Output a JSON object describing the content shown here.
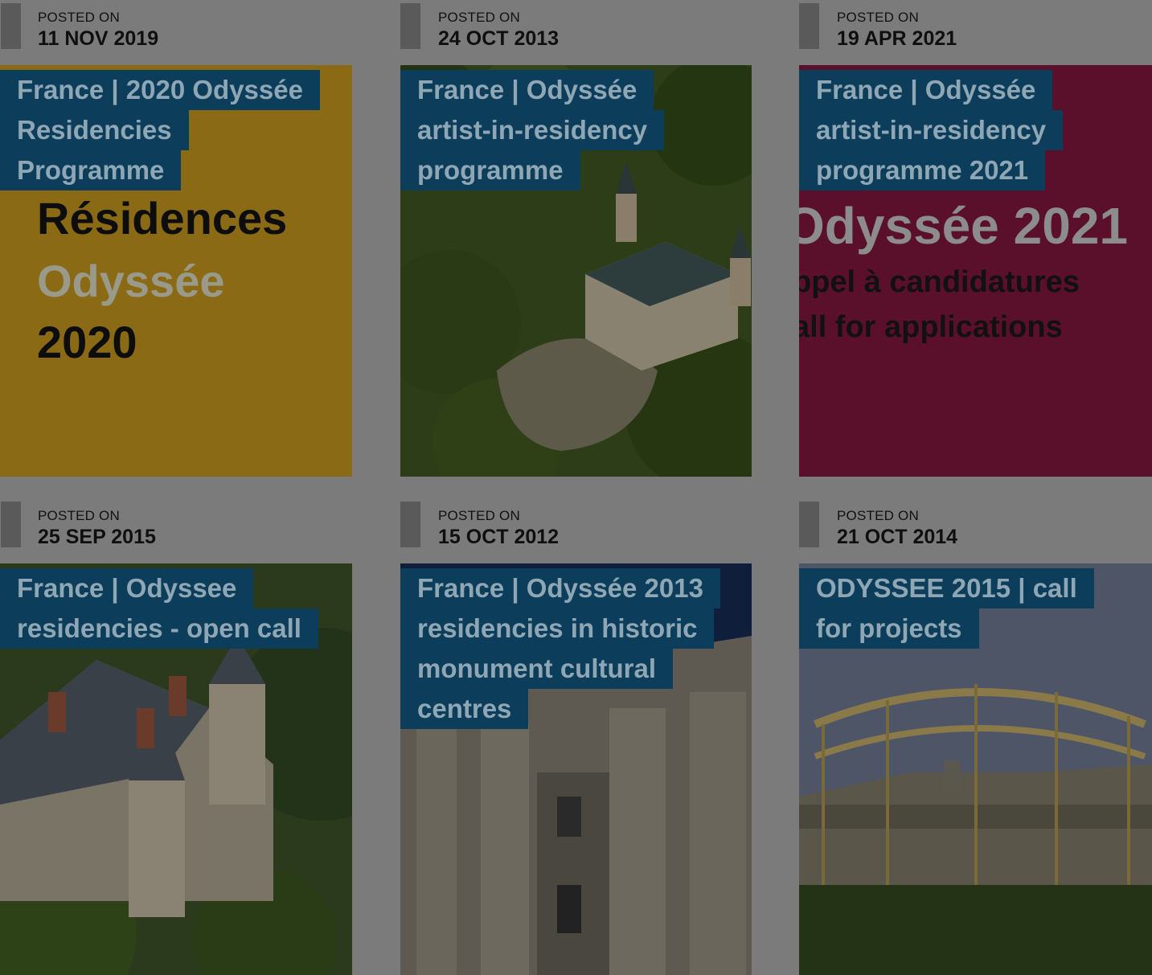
{
  "posts": [
    {
      "posted_label": "POSTED ON",
      "date": "11 NOV 2019",
      "title_lines": [
        "France | 2020 Odyssée",
        "Residencies",
        "Programme"
      ],
      "image": {
        "kind": "poster",
        "bg": "#8a6a14",
        "lines": [
          "Résidences",
          "Odyssée",
          "2020"
        ]
      }
    },
    {
      "posted_label": "POSTED ON",
      "date": "24 OCT 2013",
      "title_lines": [
        "France | Odyssée",
        "artist-in-residency",
        "programme"
      ],
      "image": {
        "kind": "chateau-aerial"
      }
    },
    {
      "posted_label": "POSTED ON",
      "date": "19 APR 2021",
      "title_lines": [
        "France | Odyssée",
        "artist-in-residency",
        "programme 2021"
      ],
      "image": {
        "kind": "poster",
        "bg": "#5a0f2a",
        "lines": [
          "Odyssée 2021",
          "ppel à candidatures",
          "all for applications"
        ]
      }
    },
    {
      "posted_label": "POSTED ON",
      "date": "25 SEP 2015",
      "title_lines": [
        "France | Odyssee",
        "residencies - open call"
      ],
      "image": {
        "kind": "chateau-towers"
      }
    },
    {
      "posted_label": "POSTED ON",
      "date": "15 OCT 2012",
      "title_lines": [
        "France | Odyssée 2013",
        "residencies in historic",
        "monument cultural",
        "centres"
      ],
      "image": {
        "kind": "facade"
      }
    },
    {
      "posted_label": "POSTED ON",
      "date": "21 OCT 2014",
      "title_lines": [
        "ODYSSEE 2015 | call",
        "for projects"
      ],
      "image": {
        "kind": "courtyard"
      }
    }
  ]
}
